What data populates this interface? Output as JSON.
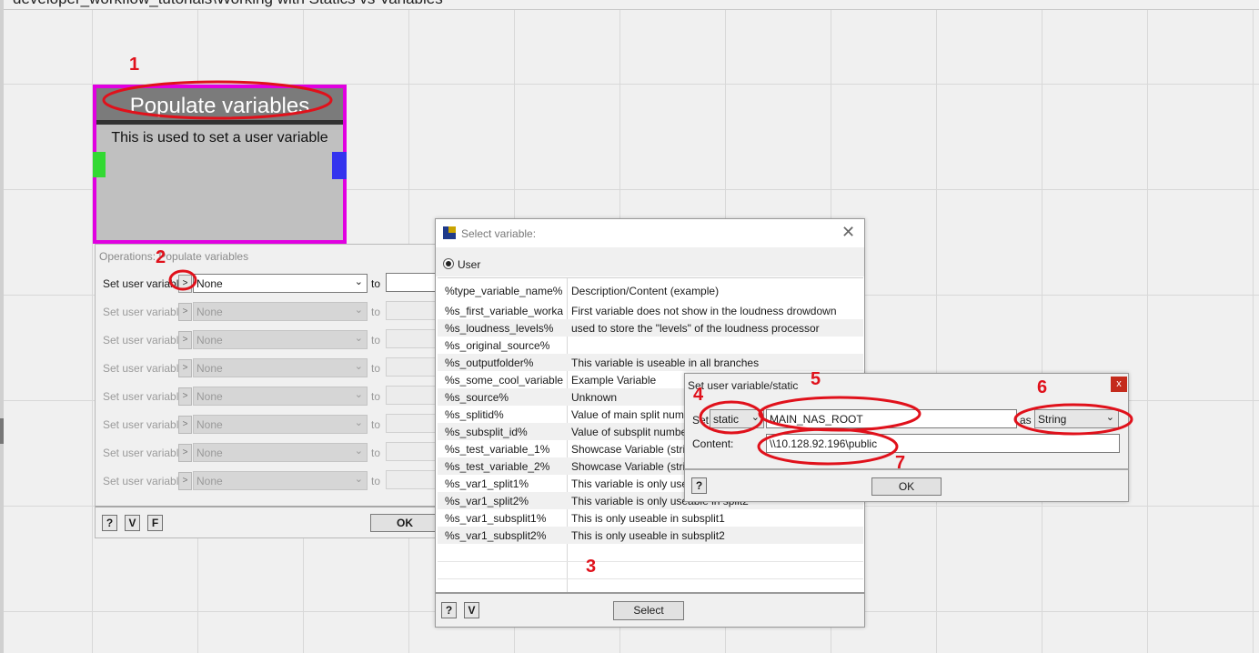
{
  "window_title": "developer_workflow_tutorials\\Working with Statics vs Variables",
  "node": {
    "title": "Populate variables",
    "description": "This is used to set a user variable"
  },
  "operations": {
    "title": "Operations: Populate variables",
    "rows": [
      {
        "label": "Set user variable",
        "arrow": ">",
        "value": "None",
        "to": "to"
      },
      {
        "label": "Set user variable",
        "arrow": ">",
        "value": "None",
        "to": "to"
      },
      {
        "label": "Set user variable",
        "arrow": ">",
        "value": "None",
        "to": "to"
      },
      {
        "label": "Set user variable",
        "arrow": ">",
        "value": "None",
        "to": "to"
      },
      {
        "label": "Set user variable",
        "arrow": ">",
        "value": "None",
        "to": "to"
      },
      {
        "label": "Set user variable",
        "arrow": ">",
        "value": "None",
        "to": "to"
      },
      {
        "label": "Set user variable",
        "arrow": ">",
        "value": "None",
        "to": "to"
      },
      {
        "label": "Set user variable",
        "arrow": ">",
        "value": "None",
        "to": "to"
      }
    ],
    "help_label": "?",
    "v_label": "V",
    "f_label": "F",
    "ok_label": "OK"
  },
  "select_variable": {
    "title": "Select variable:",
    "close": "✕",
    "radio_label": "User",
    "header": {
      "name": "%type_variable_name%",
      "desc": "Description/Content (example)"
    },
    "rows": [
      {
        "name": "%s_first_variable_worka...",
        "desc": "First variable does not show in the loudness drowdown"
      },
      {
        "name": "%s_loudness_levels%",
        "desc": "used to store the \"levels\" of the loudness processor"
      },
      {
        "name": "%s_original_source%",
        "desc": ""
      },
      {
        "name": "%s_outputfolder%",
        "desc": "This variable is useable in all branches"
      },
      {
        "name": "%s_some_cool_variable...",
        "desc": "Example Variable"
      },
      {
        "name": "%s_source%",
        "desc": "Unknown"
      },
      {
        "name": "%s_splitid%",
        "desc": "Value of main split num"
      },
      {
        "name": "%s_subsplit_id%",
        "desc": "Value of subsplit numbe"
      },
      {
        "name": "%s_test_variable_1%",
        "desc": "Showcase Variable (strin"
      },
      {
        "name": "%s_test_variable_2%",
        "desc": "Showcase Variable (strin"
      },
      {
        "name": "%s_var1_split1%",
        "desc": "This variable is only usea"
      },
      {
        "name": "%s_var1_split2%",
        "desc": "This variable is only useable in split2"
      },
      {
        "name": "%s_var1_subsplit1%",
        "desc": "This is only useable in subsplit1"
      },
      {
        "name": "%s_var1_subsplit2%",
        "desc": "This is only useable in subsplit2"
      }
    ],
    "help_label": "?",
    "v_label": "V",
    "select_label": "Select"
  },
  "static_dialog": {
    "title": "Set user variable/static",
    "close": "x",
    "set_label": "Set",
    "type_value": "static",
    "name_value": "MAIN_NAS_ROOT",
    "as_label": "as",
    "datatype_value": "String",
    "content_label": "Content:",
    "content_value": "\\\\10.128.92.196\\public",
    "help_label": "?",
    "ok_label": "OK"
  },
  "annotations": [
    "1",
    "2",
    "3",
    "4",
    "5",
    "6",
    "7"
  ],
  "colors": {
    "annotation_red": "#e0111b",
    "node_border": "#e100e1",
    "port_left": "#33d933",
    "port_right": "#3333ee"
  }
}
